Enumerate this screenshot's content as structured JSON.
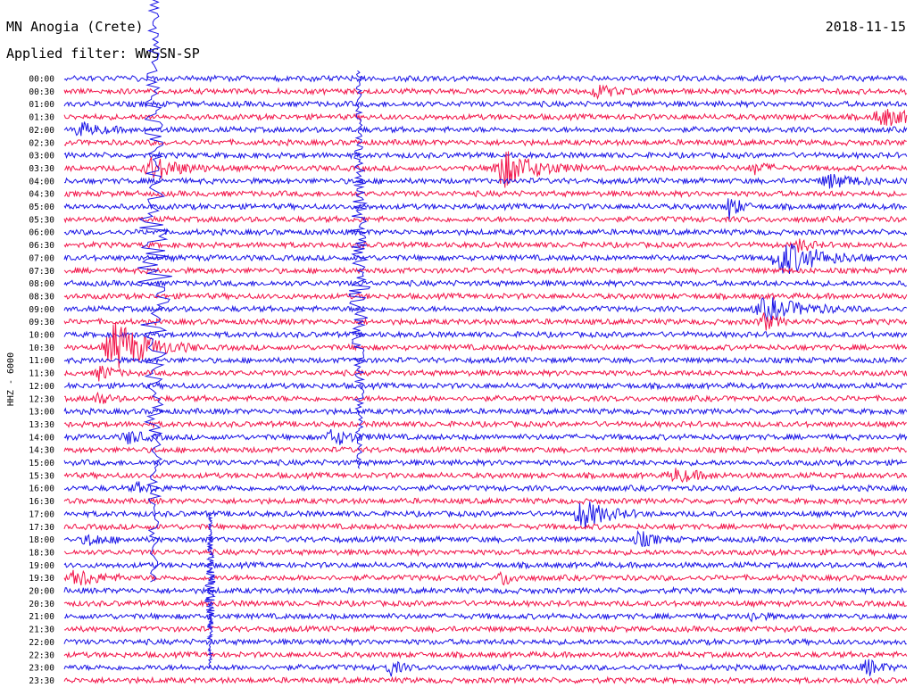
{
  "header": {
    "station": "MN Anogia (Crete)",
    "date": "2018-11-15",
    "filter": "Applied filter: WWSSN-SP"
  },
  "chart_data": {
    "type": "line",
    "title": "MN Anogia (Crete)",
    "subtitle": "Applied filter: WWSSN-SP",
    "ylabel": "HHZ - 6000",
    "xlabel": "",
    "grid": false,
    "colors": {
      "even_row": "#1a14e6",
      "odd_row": "#f2154a"
    },
    "row_labels": [
      "00:00",
      "00:30",
      "01:00",
      "01:30",
      "02:00",
      "02:30",
      "03:00",
      "03:30",
      "04:00",
      "04:30",
      "05:00",
      "05:30",
      "06:00",
      "06:30",
      "07:00",
      "07:30",
      "08:00",
      "08:30",
      "09:00",
      "09:30",
      "10:00",
      "10:30",
      "11:00",
      "11:30",
      "12:00",
      "12:30",
      "13:00",
      "13:30",
      "14:00",
      "14:30",
      "15:00",
      "15:30",
      "16:00",
      "16:30",
      "17:00",
      "17:30",
      "18:00",
      "18:30",
      "19:00",
      "19:30",
      "20:00",
      "20:30",
      "21:00",
      "21:30",
      "22:00",
      "22:30",
      "23:00",
      "23:30"
    ],
    "trace_span_minutes": 30,
    "events": [
      {
        "row": 1,
        "minute": 19.0,
        "amplitude": 7,
        "duration": 0.9
      },
      {
        "row": 3,
        "minute": 29.2,
        "amplitude": 9,
        "duration": 1.5
      },
      {
        "row": 4,
        "minute": 0.6,
        "amplitude": 7,
        "duration": 1.0
      },
      {
        "row": 7,
        "minute": 3.2,
        "amplitude": 12,
        "duration": 1.4
      },
      {
        "row": 7,
        "minute": 15.7,
        "amplitude": 20,
        "duration": 1.6
      },
      {
        "row": 7,
        "minute": 24.6,
        "amplitude": 6,
        "duration": 0.7
      },
      {
        "row": 8,
        "minute": 27.3,
        "amplitude": 7,
        "duration": 1.4
      },
      {
        "row": 10,
        "minute": 23.7,
        "amplitude": 14,
        "duration": 0.5
      },
      {
        "row": 13,
        "minute": 26.2,
        "amplitude": 8,
        "duration": 0.5
      },
      {
        "row": 14,
        "minute": 25.7,
        "amplitude": 18,
        "duration": 1.8
      },
      {
        "row": 18,
        "minute": 25.1,
        "amplitude": 12,
        "duration": 1.8
      },
      {
        "row": 19,
        "minute": 24.9,
        "amplitude": 10,
        "duration": 0.6
      },
      {
        "row": 15,
        "minute": 3.2,
        "amplitude": 220,
        "duration": 5.5
      },
      {
        "row": 15,
        "minute": 10.5,
        "amplitude": 140,
        "duration": 3.5
      },
      {
        "row": 21,
        "minute": 1.9,
        "amplitude": 28,
        "duration": 1.6
      },
      {
        "row": 23,
        "minute": 1.3,
        "amplitude": 9,
        "duration": 0.6
      },
      {
        "row": 25,
        "minute": 1.2,
        "amplitude": 7,
        "duration": 0.5
      },
      {
        "row": 28,
        "minute": 2.3,
        "amplitude": 7,
        "duration": 0.8
      },
      {
        "row": 28,
        "minute": 9.6,
        "amplitude": 8,
        "duration": 1.1
      },
      {
        "row": 31,
        "minute": 21.8,
        "amplitude": 7,
        "duration": 1.1
      },
      {
        "row": 32,
        "minute": 2.6,
        "amplitude": 5,
        "duration": 0.7
      },
      {
        "row": 34,
        "minute": 18.5,
        "amplitude": 16,
        "duration": 1.2
      },
      {
        "row": 36,
        "minute": 0.9,
        "amplitude": 6,
        "duration": 0.9
      },
      {
        "row": 36,
        "minute": 20.5,
        "amplitude": 8,
        "duration": 0.8
      },
      {
        "row": 39,
        "minute": 0.5,
        "amplitude": 9,
        "duration": 1.1
      },
      {
        "row": 39,
        "minute": 15.6,
        "amplitude": 8,
        "duration": 0.6
      },
      {
        "row": 40,
        "minute": 5.2,
        "amplitude": 55,
        "duration": 1.8
      },
      {
        "row": 42,
        "minute": 24.5,
        "amplitude": 5,
        "duration": 0.6
      },
      {
        "row": 46,
        "minute": 11.6,
        "amplitude": 9,
        "duration": 0.5
      },
      {
        "row": 46,
        "minute": 28.6,
        "amplitude": 9,
        "duration": 0.7
      }
    ]
  }
}
